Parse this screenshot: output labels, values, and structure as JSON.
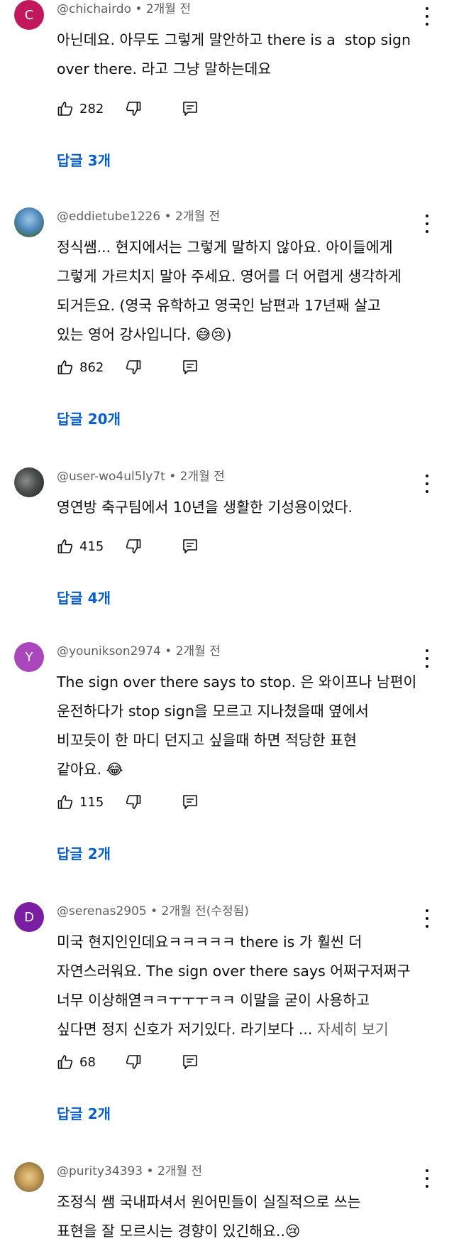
{
  "colors": {
    "link": "#065fd4",
    "muted": "#606060",
    "text": "#0f0f0f"
  },
  "comments": [
    {
      "avatar_letter": "C",
      "avatar_color": "#c2185b",
      "handle": "@chichairdo",
      "sep": "•",
      "time": "2개월 전",
      "edited": "",
      "lines": [
        "아닌데요. 아무도 그렇게 말안하고 there is a  stop sign",
        "over there. 라고 그냥 말하는데요"
      ],
      "more": "",
      "likes": "282",
      "replies": "답글 3개"
    },
    {
      "avatar_letter": "",
      "avatar_color": "",
      "handle": "@eddietube1226",
      "sep": "•",
      "time": "2개월 전",
      "edited": "",
      "lines": [
        "정식쌤... 현지에서는 그렇게 말하지 않아요. 아이들에게",
        "그렇게 가르치지 말아 주세요. 영어를 더 어렵게 생각하게",
        "되거든요. (영국 유학하고 영국인 남편과 17년째 살고",
        "있는 영어 강사입니다. 😅😢)"
      ],
      "more": "",
      "likes": "862",
      "replies": "답글 20개"
    },
    {
      "avatar_letter": "",
      "avatar_color": "",
      "handle": "@user-wo4ul5ly7t",
      "sep": "•",
      "time": "2개월 전",
      "edited": "",
      "lines": [
        "영연방 축구팀에서 10년을 생활한 기성용이었다."
      ],
      "more": "",
      "likes": "415",
      "replies": "답글 4개"
    },
    {
      "avatar_letter": "Y",
      "avatar_color": "#ab47bc",
      "handle": "@younikson2974",
      "sep": "•",
      "time": "2개월 전",
      "edited": "",
      "lines": [
        "The sign over there says to stop. 은 와이프나 남편이",
        "운전하다가 stop sign을 모르고 지나쳤을때 옆에서",
        "비꼬듯이 한 마디 던지고 싶을때 하면 적당한 표현",
        "같아요. 😂"
      ],
      "more": "",
      "likes": "115",
      "replies": "답글 2개"
    },
    {
      "avatar_letter": "D",
      "avatar_color": "#7b1fa2",
      "handle": "@serenas2905",
      "sep": "•",
      "time": "2개월 전",
      "edited": "(수정됨)",
      "lines": [
        "미국 현지인인데요ㅋㅋㅋㅋㅋ there is 가 훨씬 더",
        "자연스러워요. The sign over there says 어쩌구저쩌구",
        "너무 이상해엳ㅋㅋㅜㅜㅜㅋㅋ 이말을 굳이 사용하고",
        "싶다면 정지 신호가 저기있다. 라기보다 ..."
      ],
      "more": "자세히 보기",
      "likes": "68",
      "replies": "답글 2개"
    },
    {
      "avatar_letter": "",
      "avatar_color": "",
      "handle": "@purity34393",
      "sep": "•",
      "time": "2개월 전",
      "edited": "",
      "lines": [
        "조정식 쌤 국내파셔서 원어민들이 실질적으로 쓰는",
        "표현을 잘 모르시는 경향이 있긴해요..😢"
      ],
      "more": "",
      "likes": "",
      "replies": ""
    }
  ]
}
